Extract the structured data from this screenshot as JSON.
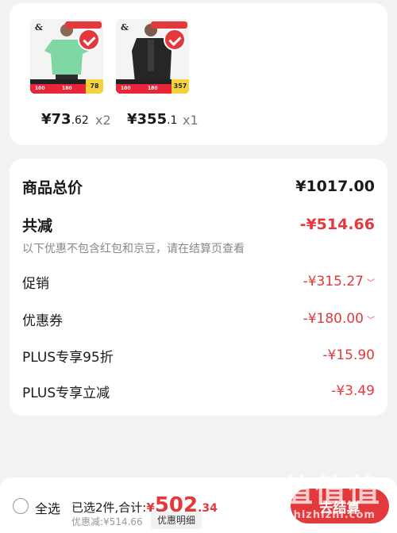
{
  "products": [
    {
      "brand_mark": "&",
      "price_int": "¥73",
      "price_dec": ".62",
      "qty": "x2",
      "badge": "78",
      "strip_a": "100",
      "strip_b": "180"
    },
    {
      "brand_mark": "&",
      "price_int": "¥355",
      "price_dec": ".1",
      "qty": "x1",
      "badge": "357",
      "strip_a": "100",
      "strip_b": "180"
    }
  ],
  "summary": {
    "total_label": "商品总价",
    "total_value": "¥1017.00",
    "reduce_label": "共减",
    "reduce_value": "-¥514.66",
    "note": "以下优惠不包含红包和京豆，请在结算页查看",
    "items": [
      {
        "label": "促销",
        "value": "-¥315.27"
      },
      {
        "label": "优惠券",
        "value": "-¥180.00"
      },
      {
        "label": "PLUS专享95折",
        "value": "-¥15.90"
      },
      {
        "label": "PLUS专享立减",
        "value": "-¥3.49"
      }
    ]
  },
  "bottom": {
    "select_all": "全选",
    "selected_prefix": "已选2件,合计:",
    "total_sym": "¥",
    "total_int": "502",
    "total_dec": ".34",
    "saved": "优惠减:¥514.66",
    "detail_button": "优惠明细",
    "checkout_button": "去结算"
  },
  "watermark": {
    "big": "值值值",
    "small": "zhizhizhi.com"
  },
  "colors": {
    "accent": "#e4393c",
    "background": "#f2f2f2"
  }
}
